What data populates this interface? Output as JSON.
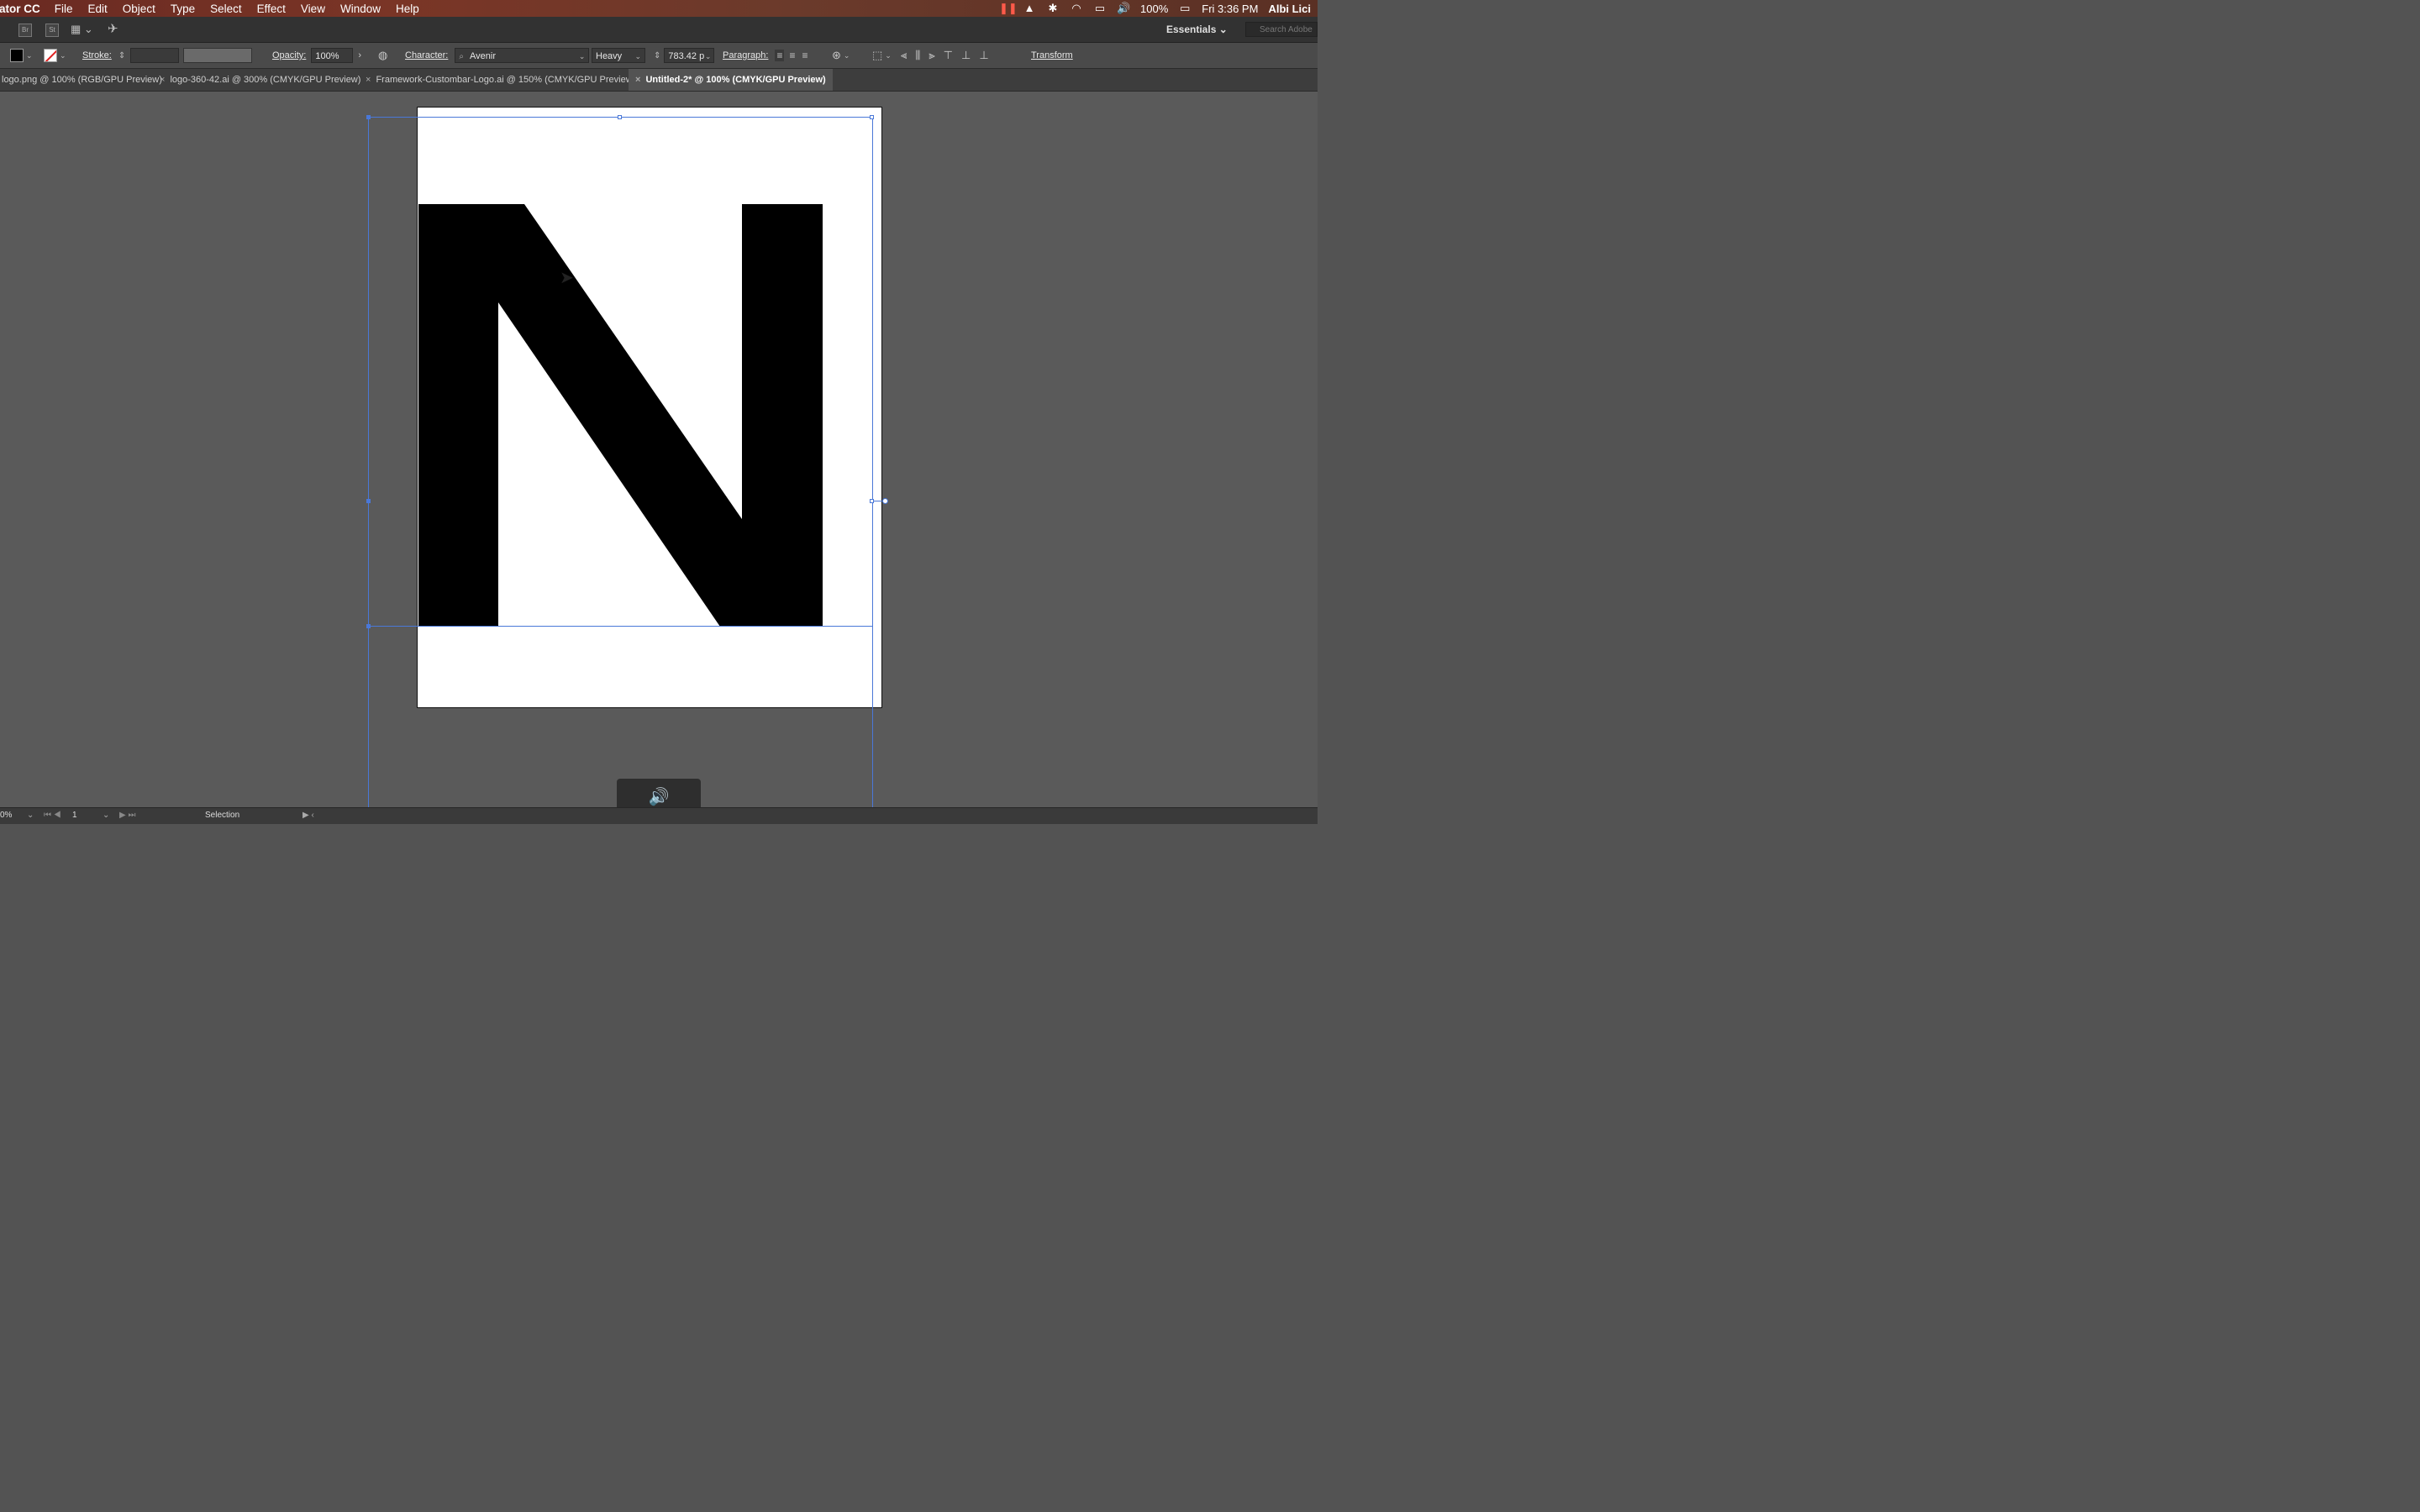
{
  "menubar": {
    "app_name": "ator CC",
    "items": [
      "File",
      "Edit",
      "Object",
      "Type",
      "Select",
      "Effect",
      "View",
      "Window",
      "Help"
    ],
    "battery": "100%",
    "clock": "Fri 3:36 PM",
    "user": "Albi Lici"
  },
  "appbar": {
    "bridge_label": "Br",
    "stock_label": "St",
    "workspace": "Essentials",
    "search_placeholder": "Search Adobe"
  },
  "control": {
    "stroke_label": "Stroke:",
    "opacity_label": "Opacity:",
    "opacity_value": "100%",
    "character_label": "Character:",
    "font_family": "Avenir",
    "font_style": "Heavy",
    "font_size": "783.42 p",
    "paragraph_label": "Paragraph:",
    "transform_label": "Transform"
  },
  "tabs": [
    {
      "label": "logo.png @ 100% (RGB/GPU Preview)"
    },
    {
      "label": "logo-360-42.ai @ 300% (CMYK/GPU Preview)"
    },
    {
      "label": "Framework-Custombar-Logo.ai @ 150% (CMYK/GPU Preview)"
    },
    {
      "label": "Untitled-2* @ 100% (CMYK/GPU Preview)"
    }
  ],
  "artboard": {
    "glyph": "N"
  },
  "status": {
    "zoom": "0%",
    "artboard_number": "1",
    "tool": "Selection"
  },
  "colors": {
    "selection": "#4a78d8",
    "fill": "#000000",
    "artboard": "#ffffff"
  }
}
